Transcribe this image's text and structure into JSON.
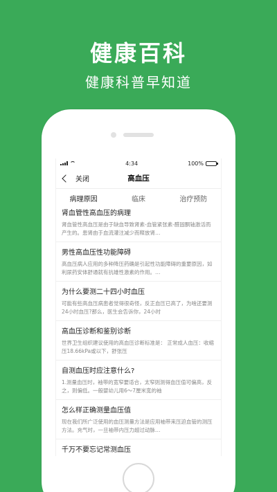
{
  "hero": {
    "title": "健康百科",
    "subtitle": "健康科普早知道"
  },
  "status_bar": {
    "time": "4:34",
    "battery": "100%",
    "battery_level": 1.0
  },
  "nav": {
    "back_label": "关闭",
    "title": "高血压"
  },
  "tabs": [
    {
      "label": "病理原因",
      "active": true
    },
    {
      "label": "临床",
      "active": false
    },
    {
      "label": "治疗预防",
      "active": false
    }
  ],
  "articles": [
    {
      "title": "肾血管性高血压的病理",
      "desc": "肾血管性高血压是由于缺血导致肾素-血管紧张素-醛固酮轴激活而产生的。患肾由于血流灌注减少而释放肾…"
    },
    {
      "title": "男性高血压性功能障碍",
      "desc": "高血压病人应用的多种降压药确是引起性功能障碍的重要原因，如利尿药安体舒通就有抗雄性激素的作用。…"
    },
    {
      "title": "为什么要测二十四小时血压",
      "desc": "可能有些高血压病患者觉得很奇怪，反正血压已高了，为啥还要测24小时血压?那么，医生会告诉你，24小时"
    },
    {
      "title": "高血压诊断和鉴别诊断",
      "desc": "世界卫生组织建议使用的高血压诊断标准是：  正常成人血压：收缩压18.66kPa或以下，舒张压"
    },
    {
      "title": "自测血压时应注意什么?",
      "desc": "1.测量血压时，袖带的宽窄要适合，太窄则测得血压值可偏高，反之，则偏低。一般婴幼儿用6～7厘米宽的袖"
    },
    {
      "title": "怎么样正确测量血压值",
      "desc": "现在我们所广泛使用的血压测量方法是应用袖带来压迫血管的测压方法。充气时，一旦袖带内压力超过动脉…"
    },
    {
      "title": "千万不要忘记常测血压",
      "desc": ""
    }
  ]
}
